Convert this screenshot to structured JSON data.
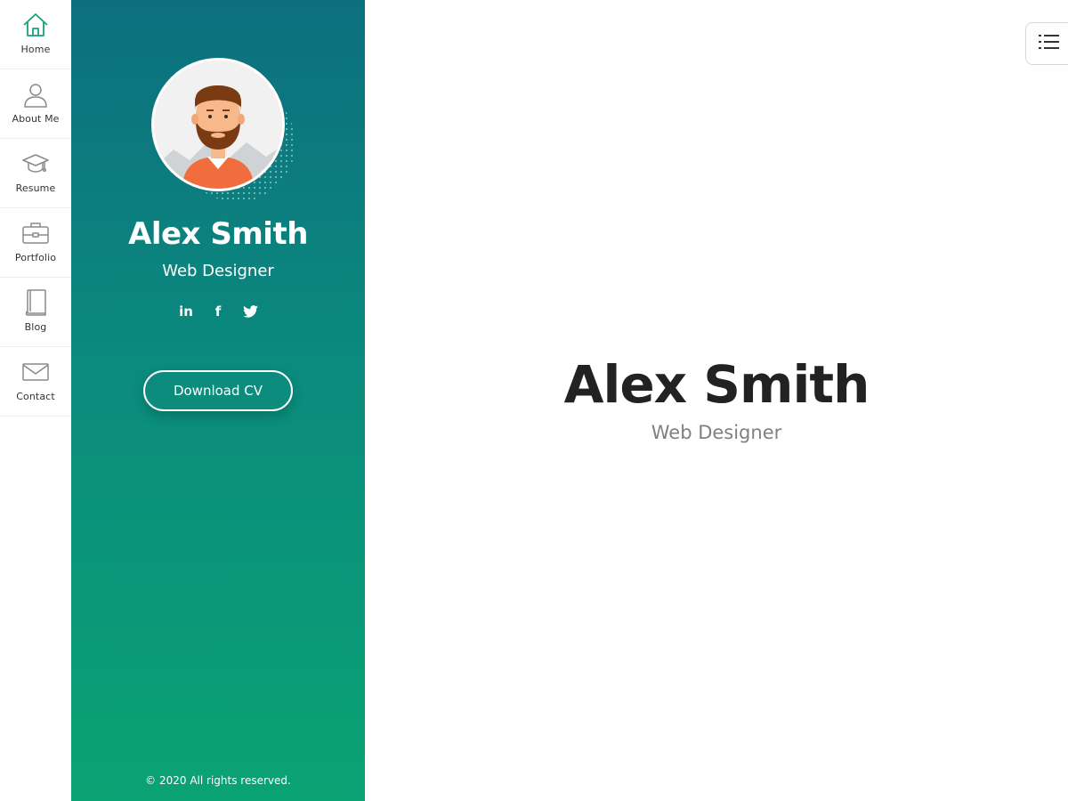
{
  "nav": {
    "items": [
      {
        "label": "Home",
        "icon": "home-icon"
      },
      {
        "label": "About Me",
        "icon": "user-icon"
      },
      {
        "label": "Resume",
        "icon": "graduation-cap-icon"
      },
      {
        "label": "Portfolio",
        "icon": "briefcase-icon"
      },
      {
        "label": "Blog",
        "icon": "book-icon"
      },
      {
        "label": "Contact",
        "icon": "envelope-icon"
      }
    ]
  },
  "profile": {
    "name": "Alex Smith",
    "role": "Web Designer",
    "socials": [
      {
        "label": "in",
        "icon": "linkedin-icon"
      },
      {
        "label": "f",
        "icon": "facebook-icon"
      },
      {
        "icon": "twitter-icon"
      }
    ],
    "cv_button": "Download CV",
    "copyright": "© 2020 All rights reserved."
  },
  "hero": {
    "name": "Alex Smith",
    "role": "Web Designer"
  },
  "menu_button": {
    "icon": "list-menu-icon"
  },
  "colors": {
    "accent": "#0aa373",
    "sidebar_top": "#0c6f7e",
    "sidebar_bottom": "#0aa373",
    "active_icon": "#1aa07a",
    "inactive_icon": "#8a8a8a"
  }
}
